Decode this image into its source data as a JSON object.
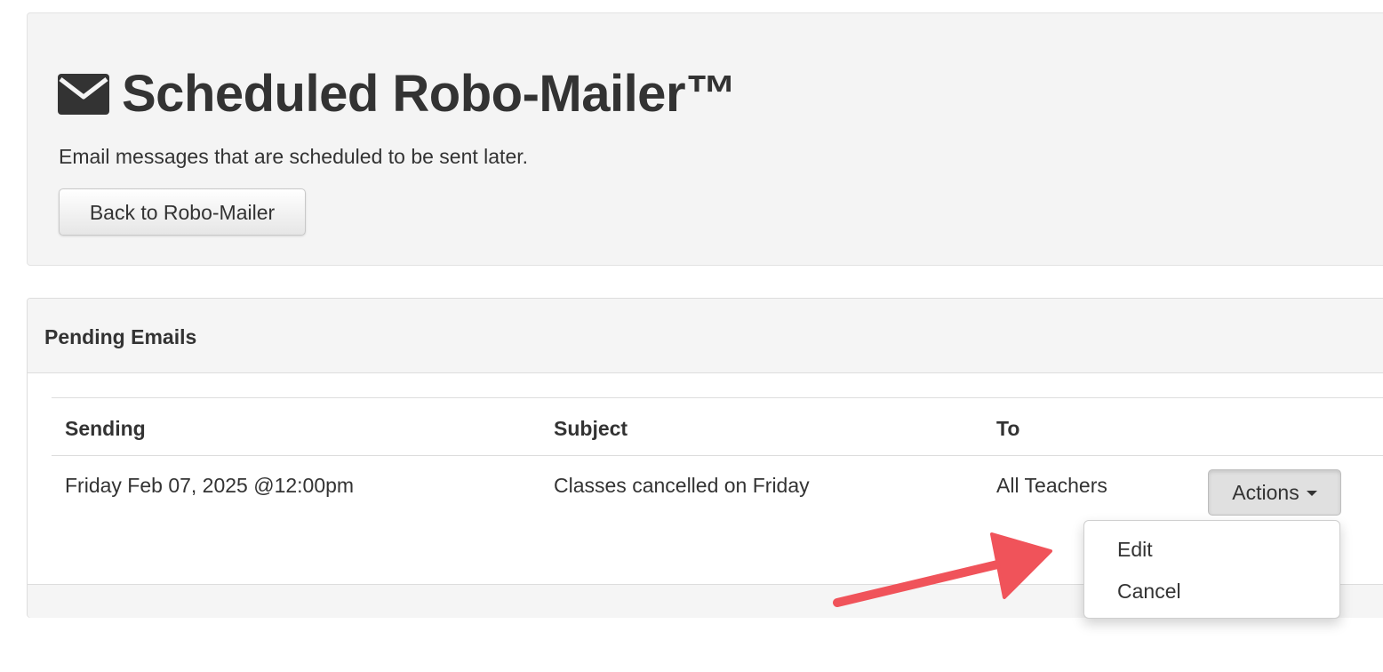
{
  "header": {
    "title": "Scheduled Robo-Mailer™",
    "description": "Email messages that are scheduled to be sent later.",
    "back_button": "Back to Robo-Mailer",
    "icon": "envelope-icon"
  },
  "panel": {
    "title": "Pending Emails",
    "columns": [
      "Sending",
      "Subject",
      "To"
    ],
    "rows": [
      {
        "sending": "Friday Feb 07, 2025 @12:00pm",
        "subject": "Classes cancelled on Friday",
        "to": "All Teachers",
        "actions_label": "Actions"
      }
    ]
  },
  "dropdown": {
    "items": [
      "Edit",
      "Cancel"
    ]
  },
  "annotation": {
    "arrow_color": "#f0535a",
    "icon": "arrow-annotation"
  }
}
